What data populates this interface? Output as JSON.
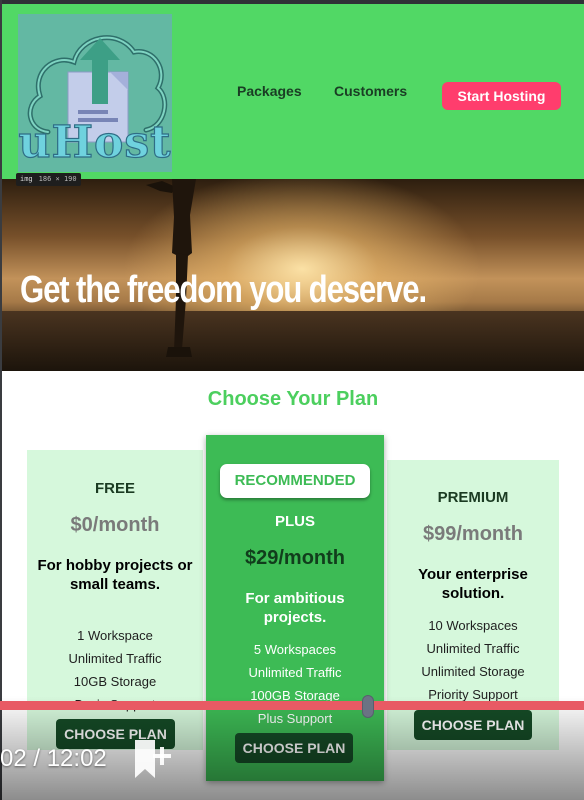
{
  "header": {
    "logo_text": "uHost",
    "nav": [
      "Packages",
      "Customers"
    ],
    "cta_label": "Start Hosting",
    "bg_color": "#51d865",
    "cta_color": "#ff3d6d"
  },
  "devtools_tag": {
    "element": "img",
    "size": "186 × 190"
  },
  "hero": {
    "title": "Get the freedom you deserve."
  },
  "plans_section": {
    "title": "Choose Your Plan",
    "plans": [
      {
        "name": "FREE",
        "price": "$0/month",
        "description": "For hobby projects or small teams.",
        "features": [
          "1 Workspace",
          "Unlimited Traffic",
          "10GB Storage",
          "Basic Support"
        ],
        "button": "CHOOSE PLAN"
      },
      {
        "badge": "RECOMMENDED",
        "name": "PLUS",
        "price": "$29/month",
        "description": "For ambitious projects.",
        "features": [
          "5 Workspaces",
          "Unlimited Traffic",
          "100GB Storage",
          "Plus Support"
        ],
        "button": "CHOOSE PLAN"
      },
      {
        "name": "PREMIUM",
        "price": "$99/month",
        "description": "Your enterprise solution.",
        "features": [
          "10 Workspaces",
          "Unlimited Traffic",
          "Unlimited Storage",
          "Priority Support"
        ],
        "button": "CHOOSE PLAN"
      }
    ]
  },
  "video_player": {
    "time_readout": "02 / 12:02",
    "progress_fraction": 0.63,
    "bar_color": "#e85a64",
    "bookmark_icon": "bookmark-add-icon"
  }
}
